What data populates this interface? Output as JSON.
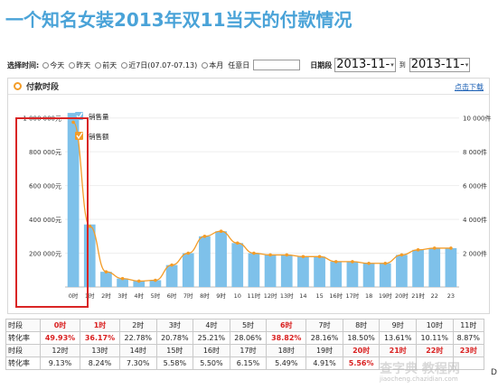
{
  "title": "一个知名女装2013年双11当天的付款情况",
  "filter": {
    "label": "选择时间:",
    "options": [
      "今天",
      "昨天",
      "前天",
      "近7日(07.07-07.13)",
      "本月"
    ],
    "any_day_label": "任意日",
    "range_label": "日期段",
    "range_start": "2013-11-",
    "range_to": "到",
    "range_end": "2013-11-"
  },
  "panel": {
    "title": "付款时段",
    "download_link": "点击下载"
  },
  "chart_data": {
    "type": "bar",
    "categories": [
      "0时",
      "1时",
      "2时",
      "3时",
      "4时",
      "5时",
      "6时",
      "7时",
      "8时",
      "9时",
      "10",
      "11时",
      "12时",
      "13时",
      "14",
      "15",
      "16时",
      "17时",
      "18",
      "19时",
      "20时",
      "21时",
      "22",
      "23"
    ],
    "series": [
      {
        "name": "销售额",
        "type": "line",
        "axis": "right",
        "color": "#f39c28",
        "values": [
          9750,
          3600,
          900,
          500,
          350,
          400,
          1300,
          2000,
          3000,
          3300,
          2600,
          2000,
          1900,
          1900,
          1800,
          1800,
          1500,
          1500,
          1400,
          1400,
          1900,
          2200,
          2300,
          2300
        ]
      },
      {
        "name": "销售量",
        "type": "bar",
        "axis": "left",
        "color": "#7ec1ea",
        "values": [
          1030000,
          370000,
          90000,
          50000,
          35000,
          40000,
          130000,
          200000,
          300000,
          330000,
          260000,
          200000,
          190000,
          190000,
          180000,
          180000,
          150000,
          150000,
          140000,
          140000,
          190000,
          220000,
          230000,
          230000
        ]
      }
    ],
    "y_left_ticks": [
      "200 000元",
      "400 000元",
      "600 000元",
      "800 000元",
      "1 000 000元"
    ],
    "y_left_values": [
      200000,
      400000,
      600000,
      800000,
      1000000
    ],
    "y_right_ticks": [
      "2 000件",
      "4 000件",
      "6 000件",
      "8 000件",
      "10 000件"
    ],
    "y_right_values": [
      2000,
      4000,
      6000,
      8000,
      10000
    ],
    "ylim": [
      0,
      1100000
    ],
    "legend_placement": "top-left"
  },
  "table": {
    "rows": [
      {
        "head": "时段",
        "cells": [
          "0时",
          "1时",
          "2时",
          "3时",
          "4时",
          "5时",
          "6时",
          "7时",
          "8时",
          "9时",
          "10时",
          "11时"
        ],
        "red": [
          0,
          1,
          6
        ]
      },
      {
        "head": "转化率",
        "cells": [
          "49.93%",
          "36.17%",
          "22.78%",
          "20.78%",
          "25.21%",
          "28.06%",
          "38.82%",
          "28.16%",
          "18.50%",
          "13.61%",
          "10.11%",
          "8.87%"
        ],
        "red": [
          0,
          1,
          6
        ]
      },
      {
        "head": "时段",
        "cells": [
          "12时",
          "13时",
          "14时",
          "15时",
          "16时",
          "17时",
          "18时",
          "19时",
          "20时",
          "21时",
          "22时",
          "23时"
        ],
        "red": [
          8,
          9,
          10,
          11
        ]
      },
      {
        "head": "转化率",
        "cells": [
          "9.13%",
          "8.24%",
          "7.30%",
          "5.58%",
          "5.50%",
          "6.15%",
          "5.49%",
          "4.91%",
          "5.56%",
          "",
          "",
          ""
        ],
        "red": [
          8
        ]
      }
    ]
  },
  "watermark": {
    "main": "查字典 教程网",
    "sub": "jiaocheng.chazidian.com"
  },
  "page_mark": "D"
}
